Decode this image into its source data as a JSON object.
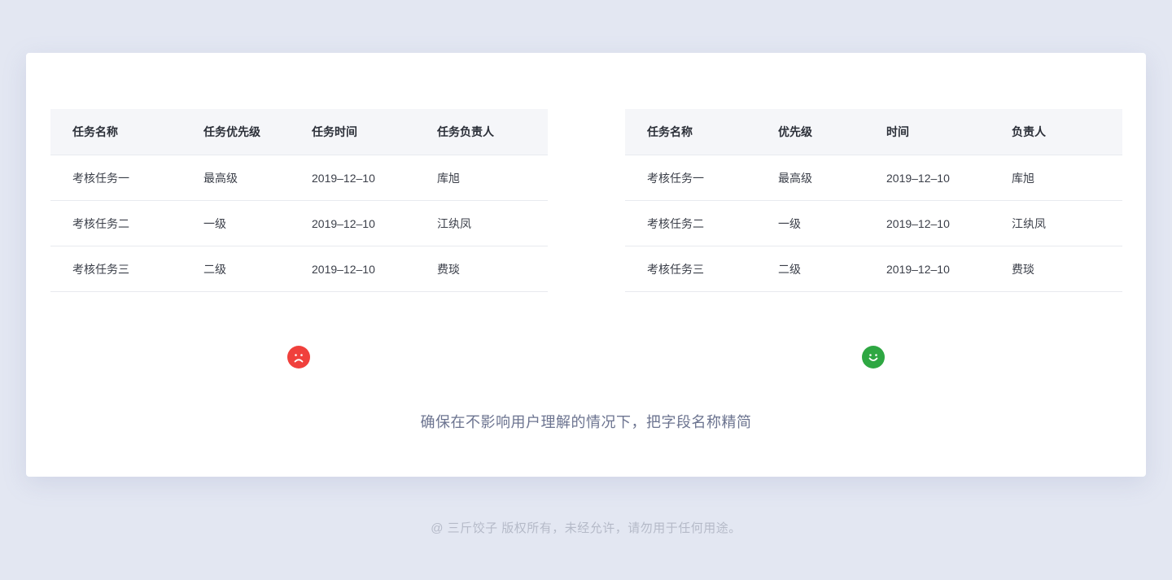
{
  "colors": {
    "background": "#e3e7f2",
    "bad_face": "#f0403c",
    "good_face": "#2ea742",
    "caption": "#6c7490"
  },
  "bad_table": {
    "headers": [
      "任务名称",
      "任务优先级",
      "任务时间",
      "任务负责人"
    ],
    "rows": [
      [
        "考核任务一",
        "最高级",
        "2019–12–10",
        "库旭"
      ],
      [
        "考核任务二",
        "一级",
        "2019–12–10",
        "江纨凤"
      ],
      [
        "考核任务三",
        "二级",
        "2019–12–10",
        "费琰"
      ]
    ]
  },
  "good_table": {
    "headers": [
      "任务名称",
      "优先级",
      "时间",
      "负责人"
    ],
    "rows": [
      [
        "考核任务一",
        "最高级",
        "2019–12–10",
        "库旭"
      ],
      [
        "考核任务二",
        "一级",
        "2019–12–10",
        "江纨凤"
      ],
      [
        "考核任务三",
        "二级",
        "2019–12–10",
        "费琰"
      ]
    ]
  },
  "icons": {
    "bad": "sad-face-icon",
    "good": "smile-face-icon"
  },
  "caption": "确保在不影响用户理解的情况下，把字段名称精简",
  "footer": "@ 三斤饺子   版权所有，未经允许，请勿用于任何用途。"
}
